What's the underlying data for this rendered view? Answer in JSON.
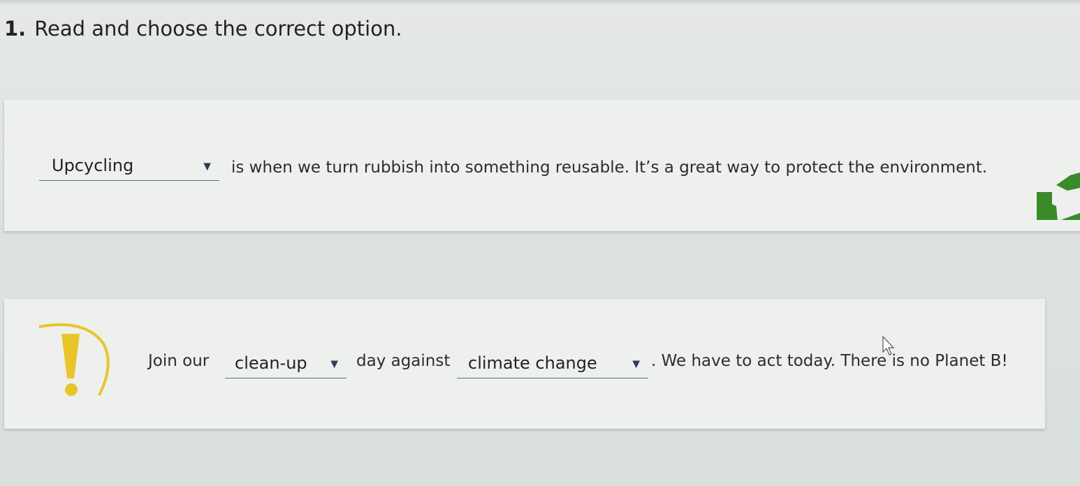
{
  "exercise": {
    "number": "1.",
    "instruction": "Read and choose the correct option."
  },
  "item1": {
    "dropdown_value": "Upcycling",
    "text": "is when we turn rubbish into something reusable. It’s a great way to protect the environment.",
    "icon": "recycle-icon",
    "icon_color": "#3a8a2a"
  },
  "item2": {
    "text_before": "Join our",
    "dropdown1_value": "clean-up",
    "text_middle": "day against",
    "dropdown2_value": "climate change",
    "text_after": ". We have to act today. There is no Planet B!",
    "icon": "warning-exclamation-icon",
    "icon_color": "#e9c52a"
  },
  "colors": {
    "underline": "#5b6e88",
    "caret": "#2d3d5c",
    "card_bg": "#eef0ee"
  }
}
